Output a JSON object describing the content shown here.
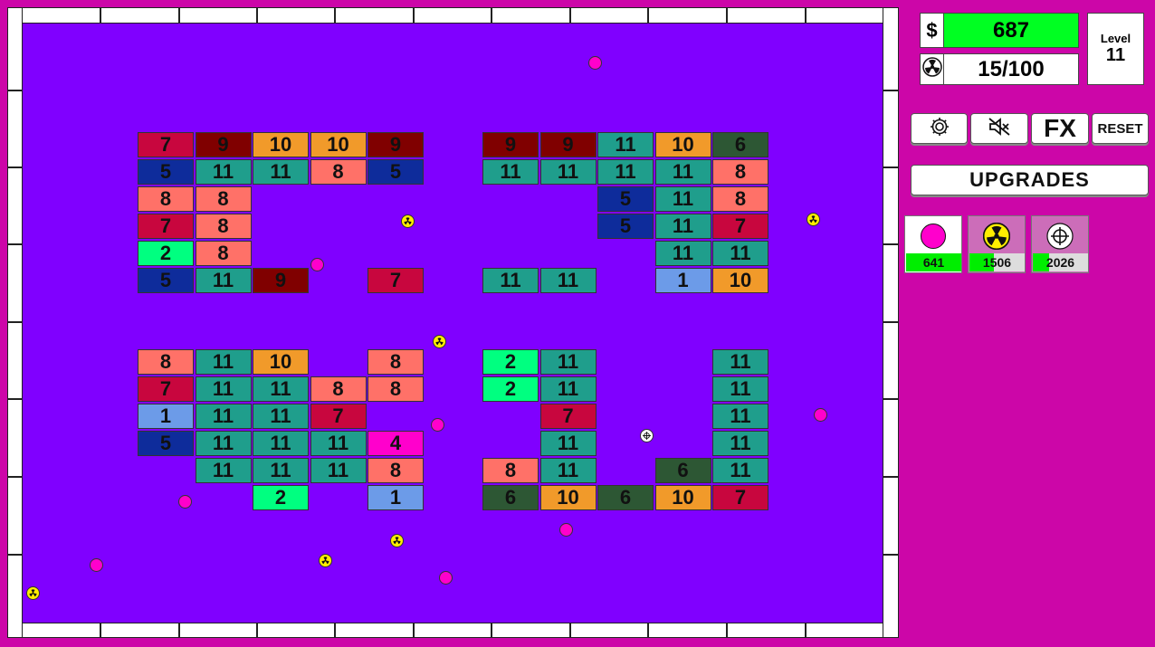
{
  "hud": {
    "money_symbol": "$",
    "money": "687",
    "ball_count": "15/100",
    "level_label": "Level",
    "level": "11"
  },
  "buttons": {
    "fx": "FX",
    "reset": "RESET",
    "upgrades": "UPGRADES"
  },
  "shop": [
    {
      "type": "basic",
      "cost": "641",
      "progress": 1.0
    },
    {
      "type": "nuke",
      "cost": "1506",
      "progress": 0.45
    },
    {
      "type": "sniper",
      "cost": "2026",
      "progress": 0.3
    }
  ],
  "colors": {
    "1": "#6c9be8",
    "2": "#00ff80",
    "4": "#ff00cc",
    "5": "#0e2c9b",
    "6": "#2d5734",
    "7": "#c8063e",
    "8": "#ff7168",
    "9": "#800000",
    "10": "#f19a2a",
    "11": "#1f9e8c"
  },
  "bricks": [
    {
      "c": 0,
      "r": 0,
      "v": "7"
    },
    {
      "c": 1,
      "r": 0,
      "v": "9"
    },
    {
      "c": 2,
      "r": 0,
      "v": "10"
    },
    {
      "c": 3,
      "r": 0,
      "v": "10"
    },
    {
      "c": 4,
      "r": 0,
      "v": "9"
    },
    {
      "c": 6,
      "r": 0,
      "v": "9"
    },
    {
      "c": 7,
      "r": 0,
      "v": "9"
    },
    {
      "c": 8,
      "r": 0,
      "v": "11"
    },
    {
      "c": 9,
      "r": 0,
      "v": "10"
    },
    {
      "c": 10,
      "r": 0,
      "v": "6"
    },
    {
      "c": 0,
      "r": 1,
      "v": "5"
    },
    {
      "c": 1,
      "r": 1,
      "v": "11"
    },
    {
      "c": 2,
      "r": 1,
      "v": "11"
    },
    {
      "c": 3,
      "r": 1,
      "v": "8"
    },
    {
      "c": 4,
      "r": 1,
      "v": "5"
    },
    {
      "c": 6,
      "r": 1,
      "v": "11"
    },
    {
      "c": 7,
      "r": 1,
      "v": "11"
    },
    {
      "c": 8,
      "r": 1,
      "v": "11"
    },
    {
      "c": 9,
      "r": 1,
      "v": "11"
    },
    {
      "c": 10,
      "r": 1,
      "v": "8"
    },
    {
      "c": 0,
      "r": 2,
      "v": "8"
    },
    {
      "c": 1,
      "r": 2,
      "v": "8"
    },
    {
      "c": 8,
      "r": 2,
      "v": "5"
    },
    {
      "c": 9,
      "r": 2,
      "v": "11"
    },
    {
      "c": 10,
      "r": 2,
      "v": "8"
    },
    {
      "c": 0,
      "r": 3,
      "v": "7"
    },
    {
      "c": 1,
      "r": 3,
      "v": "8"
    },
    {
      "c": 8,
      "r": 3,
      "v": "5"
    },
    {
      "c": 9,
      "r": 3,
      "v": "11"
    },
    {
      "c": 10,
      "r": 3,
      "v": "7"
    },
    {
      "c": 0,
      "r": 4,
      "v": "2"
    },
    {
      "c": 1,
      "r": 4,
      "v": "8"
    },
    {
      "c": 9,
      "r": 4,
      "v": "11"
    },
    {
      "c": 10,
      "r": 4,
      "v": "11"
    },
    {
      "c": 0,
      "r": 5,
      "v": "5"
    },
    {
      "c": 1,
      "r": 5,
      "v": "11"
    },
    {
      "c": 2,
      "r": 5,
      "v": "9"
    },
    {
      "c": 4,
      "r": 5,
      "v": "7"
    },
    {
      "c": 6,
      "r": 5,
      "v": "11"
    },
    {
      "c": 7,
      "r": 5,
      "v": "11"
    },
    {
      "c": 9,
      "r": 5,
      "v": "1"
    },
    {
      "c": 10,
      "r": 5,
      "v": "10"
    },
    {
      "c": 0,
      "r": 8,
      "v": "8"
    },
    {
      "c": 1,
      "r": 8,
      "v": "11"
    },
    {
      "c": 2,
      "r": 8,
      "v": "10"
    },
    {
      "c": 4,
      "r": 8,
      "v": "8"
    },
    {
      "c": 6,
      "r": 8,
      "v": "2"
    },
    {
      "c": 7,
      "r": 8,
      "v": "11"
    },
    {
      "c": 10,
      "r": 8,
      "v": "11"
    },
    {
      "c": 0,
      "r": 9,
      "v": "7"
    },
    {
      "c": 1,
      "r": 9,
      "v": "11"
    },
    {
      "c": 2,
      "r": 9,
      "v": "11"
    },
    {
      "c": 3,
      "r": 9,
      "v": "8"
    },
    {
      "c": 4,
      "r": 9,
      "v": "8"
    },
    {
      "c": 6,
      "r": 9,
      "v": "2"
    },
    {
      "c": 7,
      "r": 9,
      "v": "11"
    },
    {
      "c": 10,
      "r": 9,
      "v": "11"
    },
    {
      "c": 0,
      "r": 10,
      "v": "1"
    },
    {
      "c": 1,
      "r": 10,
      "v": "11"
    },
    {
      "c": 2,
      "r": 10,
      "v": "11"
    },
    {
      "c": 3,
      "r": 10,
      "v": "7"
    },
    {
      "c": 7,
      "r": 10,
      "v": "7"
    },
    {
      "c": 10,
      "r": 10,
      "v": "11"
    },
    {
      "c": 0,
      "r": 11,
      "v": "5"
    },
    {
      "c": 1,
      "r": 11,
      "v": "11"
    },
    {
      "c": 2,
      "r": 11,
      "v": "11"
    },
    {
      "c": 3,
      "r": 11,
      "v": "11"
    },
    {
      "c": 4,
      "r": 11,
      "v": "4"
    },
    {
      "c": 7,
      "r": 11,
      "v": "11"
    },
    {
      "c": 10,
      "r": 11,
      "v": "11"
    },
    {
      "c": 1,
      "r": 12,
      "v": "11"
    },
    {
      "c": 2,
      "r": 12,
      "v": "11"
    },
    {
      "c": 3,
      "r": 12,
      "v": "11"
    },
    {
      "c": 4,
      "r": 12,
      "v": "8"
    },
    {
      "c": 6,
      "r": 12,
      "v": "8"
    },
    {
      "c": 7,
      "r": 12,
      "v": "11"
    },
    {
      "c": 9,
      "r": 12,
      "v": "6"
    },
    {
      "c": 10,
      "r": 12,
      "v": "11"
    },
    {
      "c": 2,
      "r": 13,
      "v": "2"
    },
    {
      "c": 4,
      "r": 13,
      "v": "1"
    },
    {
      "c": 6,
      "r": 13,
      "v": "6"
    },
    {
      "c": 7,
      "r": 13,
      "v": "10"
    },
    {
      "c": 8,
      "r": 13,
      "v": "6"
    },
    {
      "c": 9,
      "r": 13,
      "v": "10"
    },
    {
      "c": 10,
      "r": 13,
      "v": "7"
    }
  ]
}
